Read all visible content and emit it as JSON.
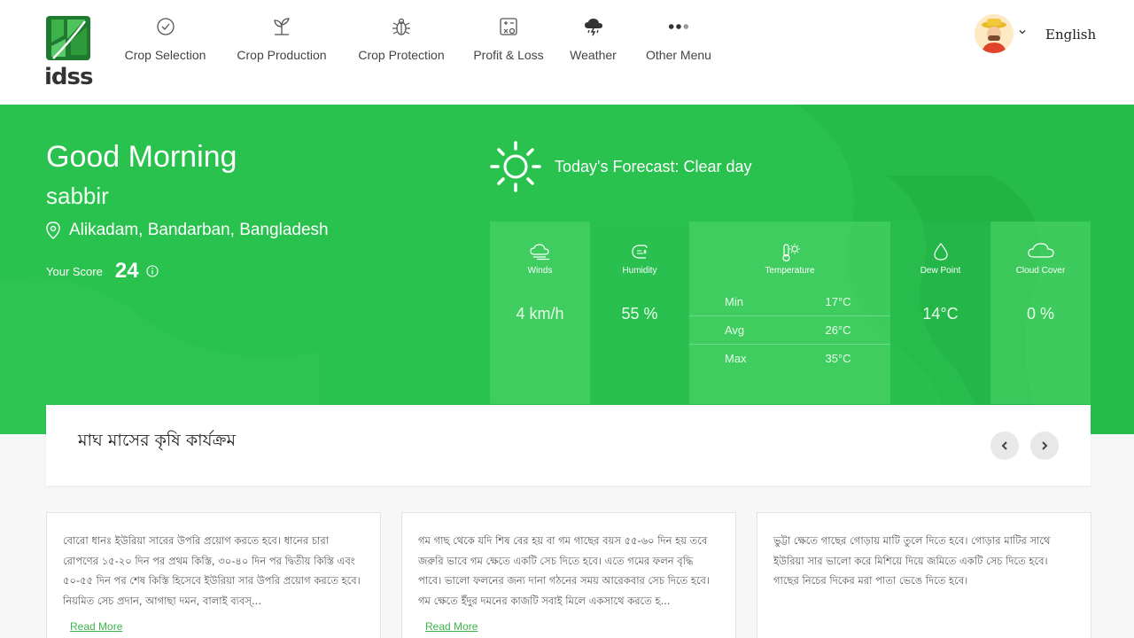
{
  "brand": {
    "name": "idss"
  },
  "nav": [
    {
      "label": "Crop Selection",
      "icon": "check-circle-icon"
    },
    {
      "label": "Crop Production",
      "icon": "sprout-icon"
    },
    {
      "label": "Crop Protection",
      "icon": "bug-icon"
    },
    {
      "label": "Profit & Loss",
      "icon": "calculator-icon"
    },
    {
      "label": "Weather",
      "icon": "storm-cloud-icon"
    },
    {
      "label": "Other Menu",
      "icon": "more-dots-icon"
    }
  ],
  "header": {
    "language": "English",
    "avatar_icon": "farmer-avatar-icon"
  },
  "hero": {
    "greeting": "Good Morning",
    "username": "sabbir",
    "location": "Alikadam, Bandarban, Bangladesh",
    "score_label": "Your Score",
    "score_value": "24",
    "forecast": "Today's Forecast: Clear day",
    "accent_color": "#2ac24f"
  },
  "weather": {
    "winds": {
      "label": "Winds",
      "value": "4 km/h"
    },
    "humidity": {
      "label": "Humidity",
      "value": "55 %"
    },
    "temperature": {
      "label": "Temperature",
      "rows": [
        {
          "key": "Min",
          "value": "17°C"
        },
        {
          "key": "Avg",
          "value": "26°C"
        },
        {
          "key": "Max",
          "value": "35°C"
        }
      ]
    },
    "dew_point": {
      "label": "Dew Point",
      "value": "14°C"
    },
    "cloud_cover": {
      "label": "Cloud Cover",
      "value": "0 %"
    }
  },
  "activities": {
    "title": "মাঘ মাসের কৃষি কার্যক্রম",
    "cards": [
      {
        "text": "বোরো ধানঃ ইউরিয়া সারের উপরি প্রয়োগ করতে হবে। ধানের চারা রোপণের ১৫-২০ দিন পর প্রথম কিস্তি, ৩০-৪০ দিন পর দ্বিতীয় কিস্তি এবং ৫০-৫৫ দিন পর শেষ কিস্তি হিসেবে ইউরিয়া সার উপরি প্রয়োগ করতে হবে। নিয়মিত সেচ প্রদান, আগাছা দমন, বালাই ব্যবস্...",
        "link": "Read More"
      },
      {
        "text": "গম গাছ থেকে যদি শিষ বের হয় বা গম গাছের বয়স ৫৫-৬০ দিন হয় তবে জরুরি ভাবে গম ক্ষেতে একটি সেচ দিতে হবে। এতে গমের ফলন বৃদ্ধি পাবে। ভালো ফলনের জন্য দানা গঠনের সময় আরেকবার সেচ দিতে হবে। গম ক্ষেতে ইঁদুর দমনের কাজটি সবাই মিলে একসাথে করতে হ...",
        "link": "Read More"
      },
      {
        "text": "ভুট্টা ক্ষেতে গাছের গোড়ায় মাটি তুলে দিতে হবে। গোড়ার মাটির সাথে ইউরিয়া সার ভালো করে মিশিয়ে দিয়ে জমিতে একটি সেচ দিতে হবে। গাছের নিচের দিকের মরা পাতা ভেঙে দিতে হবে।",
        "link": ""
      }
    ]
  }
}
